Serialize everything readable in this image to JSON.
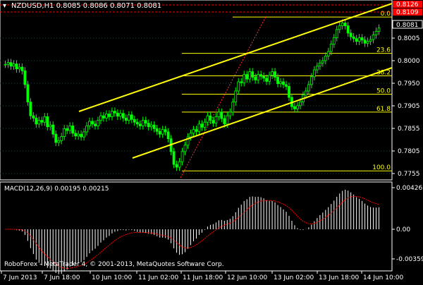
{
  "window": {
    "symbol_header": "NZDUSD,H1 0.8085 0.8086 0.8071 0.8081",
    "copyright": "RoboForex - MetaTrader 4, © 2001-2013, MetaQuotes Software Corp."
  },
  "colors": {
    "background": "#000000",
    "candles": "#00ff00",
    "grid": "#1e4a4a",
    "channel": "#ffff00",
    "fib": "#ffff00",
    "macd_hist": "#ffffff",
    "macd_signal": "#ff0000",
    "price_high_lines": "#ff0000",
    "label_box": "#ff0000",
    "axis_text": "#ffffff"
  },
  "price_axis": {
    "ticks": [
      "0.8005",
      "0.8000",
      "0.7950",
      "0.7905",
      "0.7855",
      "0.7805",
      "0.7755"
    ],
    "current": "0.8081",
    "red_labels": [
      "0.8126",
      "0.8109"
    ]
  },
  "fibonacci": [
    {
      "label": "0.0",
      "price": 0.8105
    },
    {
      "label": "23.6",
      "price": 0.8026
    },
    {
      "label": "38.2",
      "price": 0.7977
    },
    {
      "label": "50.0",
      "price": 0.7937
    },
    {
      "label": "61.8",
      "price": 0.7898
    },
    {
      "label": "100.0",
      "price": 0.777
    }
  ],
  "time_axis": [
    "7 Jun 2013",
    "7 Jun 18:00",
    "10 Jun 10:00",
    "11 Jun 02:00",
    "11 Jun 18:00",
    "12 Jun 10:00",
    "13 Jun 02:00",
    "13 Jun 18:00",
    "14 Jun 10:00"
  ],
  "macd": {
    "title": "MACD(12,26,9) 0.00195 0.00215",
    "ticks": [
      "0.00426",
      "0.00",
      "-0.00359"
    ],
    "range": [
      -0.00359,
      0.00426
    ]
  },
  "chart_data": {
    "type": "candlestick",
    "price_range": [
      0.7755,
      0.8136
    ],
    "closes": [
      0.8002,
      0.8006,
      0.7998,
      0.8003,
      0.7992,
      0.7996,
      0.7988,
      0.7958,
      0.792,
      0.789,
      0.7885,
      0.7872,
      0.788,
      0.7876,
      0.7888,
      0.7866,
      0.787,
      0.785,
      0.7832,
      0.7836,
      0.7845,
      0.7862,
      0.7858,
      0.7868,
      0.7852,
      0.7846,
      0.785,
      0.7844,
      0.7855,
      0.7868,
      0.7878,
      0.7872,
      0.7868,
      0.788,
      0.789,
      0.7885,
      0.7894,
      0.7888,
      0.79,
      0.7896,
      0.7889,
      0.7895,
      0.7885,
      0.788,
      0.7892,
      0.7882,
      0.7876,
      0.7872,
      0.7868,
      0.788,
      0.7874,
      0.7866,
      0.787,
      0.7862,
      0.7856,
      0.785,
      0.786,
      0.7855,
      0.784,
      0.7812,
      0.7784,
      0.7778,
      0.779,
      0.7812,
      0.7826,
      0.7844,
      0.7852,
      0.786,
      0.7856,
      0.7872,
      0.7865,
      0.7876,
      0.789,
      0.788,
      0.7874,
      0.7888,
      0.7898,
      0.7884,
      0.7872,
      0.789,
      0.7898,
      0.792,
      0.7944,
      0.7964,
      0.7962,
      0.798,
      0.797,
      0.7986,
      0.7974,
      0.7968,
      0.798,
      0.7976,
      0.7972,
      0.7965,
      0.7978,
      0.7986,
      0.7974,
      0.796,
      0.7964,
      0.7958,
      0.7954,
      0.793,
      0.791,
      0.7905,
      0.7912,
      0.792,
      0.7935,
      0.7944,
      0.7958,
      0.7975,
      0.799,
      0.7998,
      0.8005,
      0.801,
      0.802,
      0.803,
      0.8046,
      0.806,
      0.8078,
      0.8086,
      0.8092,
      0.8086,
      0.807,
      0.8062,
      0.8058,
      0.8052,
      0.806,
      0.8055,
      0.8048,
      0.8052,
      0.8056,
      0.8066,
      0.8074,
      0.8081
    ]
  }
}
